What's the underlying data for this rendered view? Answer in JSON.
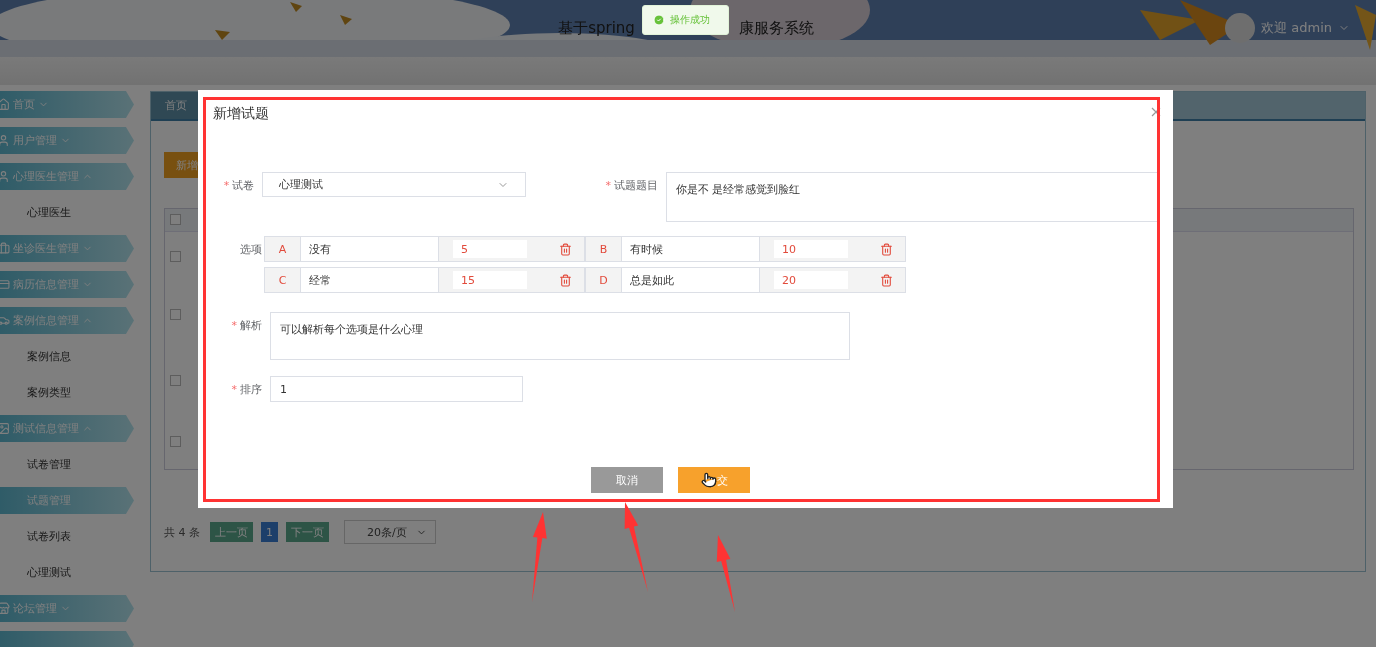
{
  "header": {
    "title_left": "基于spring",
    "title_right": "康服务系统",
    "user": "欢迎 admin"
  },
  "toast": {
    "text": "操作成功"
  },
  "sidebar": {
    "items": [
      {
        "label": "首页",
        "expanded": false
      },
      {
        "label": "用户管理",
        "expanded": false
      },
      {
        "label": "心理医生管理",
        "expanded": true,
        "children": [
          {
            "label": "心理医生",
            "selected": false
          }
        ]
      },
      {
        "label": "坐诊医生管理",
        "expanded": false
      },
      {
        "label": "病历信息管理",
        "expanded": false
      },
      {
        "label": "案例信息管理",
        "expanded": true,
        "children": [
          {
            "label": "案例信息",
            "selected": false
          },
          {
            "label": "案例类型",
            "selected": false
          }
        ]
      },
      {
        "label": "测试信息管理",
        "expanded": true,
        "children": [
          {
            "label": "试卷管理",
            "selected": false
          },
          {
            "label": "试题管理",
            "selected": true
          },
          {
            "label": "试卷列表",
            "selected": false
          },
          {
            "label": "心理测试",
            "selected": false
          }
        ]
      },
      {
        "label": "论坛管理",
        "expanded": false
      }
    ]
  },
  "main": {
    "tab": "首页",
    "add_button": "新增",
    "table": {
      "header_checked": false,
      "rows": [
        {
          "checked": false
        },
        {
          "checked": false
        },
        {
          "checked": false
        },
        {
          "checked": false
        }
      ]
    },
    "pagination": {
      "total": "共 4 条",
      "prev": "上一页",
      "pages": [
        {
          "label": "1",
          "selected": true
        }
      ],
      "next": "下一页",
      "page_size": "20条/页"
    }
  },
  "modal": {
    "title": "新增试题",
    "paper": {
      "required_mark": "*",
      "label": "试卷",
      "value": "心理测试"
    },
    "question": {
      "required_mark": "*",
      "label": "试题题目",
      "value": "你是不 是经常感觉到脸红"
    },
    "options": {
      "label": "选项",
      "items": [
        {
          "letter": "A",
          "text": "没有",
          "score": "5"
        },
        {
          "letter": "B",
          "text": "有时候",
          "score": "10"
        },
        {
          "letter": "C",
          "text": "经常",
          "score": "15"
        },
        {
          "letter": "D",
          "text": "总是如此",
          "score": "20"
        }
      ]
    },
    "analysis": {
      "required_mark": "*",
      "label": "解析",
      "value": "可以解析每个选项是什么心理"
    },
    "order": {
      "required_mark": "*",
      "label": "排序",
      "value": "1"
    },
    "cancel": "取消",
    "submit": "交"
  }
}
